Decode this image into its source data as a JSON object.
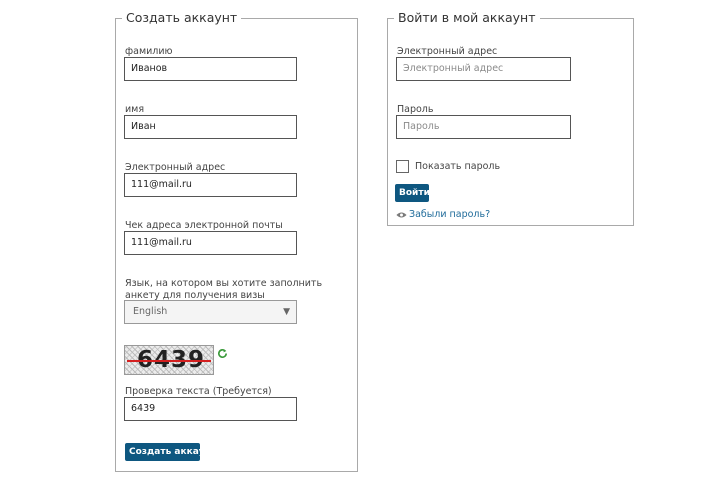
{
  "create_account": {
    "legend": "Создать аккаунт",
    "last_name": {
      "label": "фамилию",
      "value": "Иванов"
    },
    "first_name": {
      "label": "имя",
      "value": "Иван"
    },
    "email": {
      "label": "Электронный адрес",
      "value": "111@mail.ru"
    },
    "email_confirm": {
      "label": "Чек адреса электронной почты",
      "value": "111@mail.ru"
    },
    "language": {
      "label": "Язык, на котором вы хотите заполнить анкету для получения визы",
      "selected": "English"
    },
    "captcha": {
      "image_text": "6439",
      "refresh_icon": "refresh-icon",
      "label": "Проверка текста (Требуется)",
      "value": "6439"
    },
    "submit_label": "Создать аккаунт"
  },
  "login": {
    "legend": "Войти в мой аккаунт",
    "email": {
      "label": "Электронный адрес",
      "placeholder": "Электронный адрес"
    },
    "password": {
      "label": "Пароль",
      "placeholder": "Пароль"
    },
    "show_password_label": "Показать пароль",
    "submit_label": "Войти",
    "forgot_label": "Забыли пароль?",
    "forgot_icon": "eye-icon"
  },
  "colors": {
    "button": "#0e5780",
    "link": "#1f6b9a",
    "border": "#a9a9a9"
  }
}
